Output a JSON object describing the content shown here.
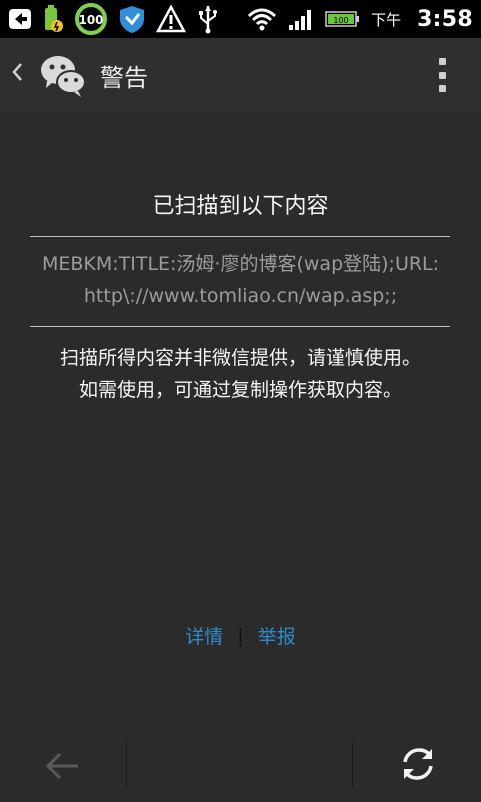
{
  "status_bar": {
    "ampm": "下午",
    "time": "3:58",
    "battery_circle": "100",
    "battery_level": "100"
  },
  "title_bar": {
    "title": "警告"
  },
  "content": {
    "heading": "已扫描到以下内容",
    "scanned_line1": "MEBKM:TITLE:汤姆·廖的博客(wap登陆);URL:",
    "scanned_line2": "http\\://www.tomliao.cn/wap.asp;;",
    "warning_line1": "扫描所得内容并非微信提供，请谨慎使用。",
    "warning_line2": "如需使用，可通过复制操作获取内容。",
    "detail_link": "详情",
    "separator": "|",
    "report_link": "举报"
  },
  "colors": {
    "background": "#2b2b2b",
    "link": "#2e8ac8",
    "muted_text": "#9c9c9c"
  }
}
